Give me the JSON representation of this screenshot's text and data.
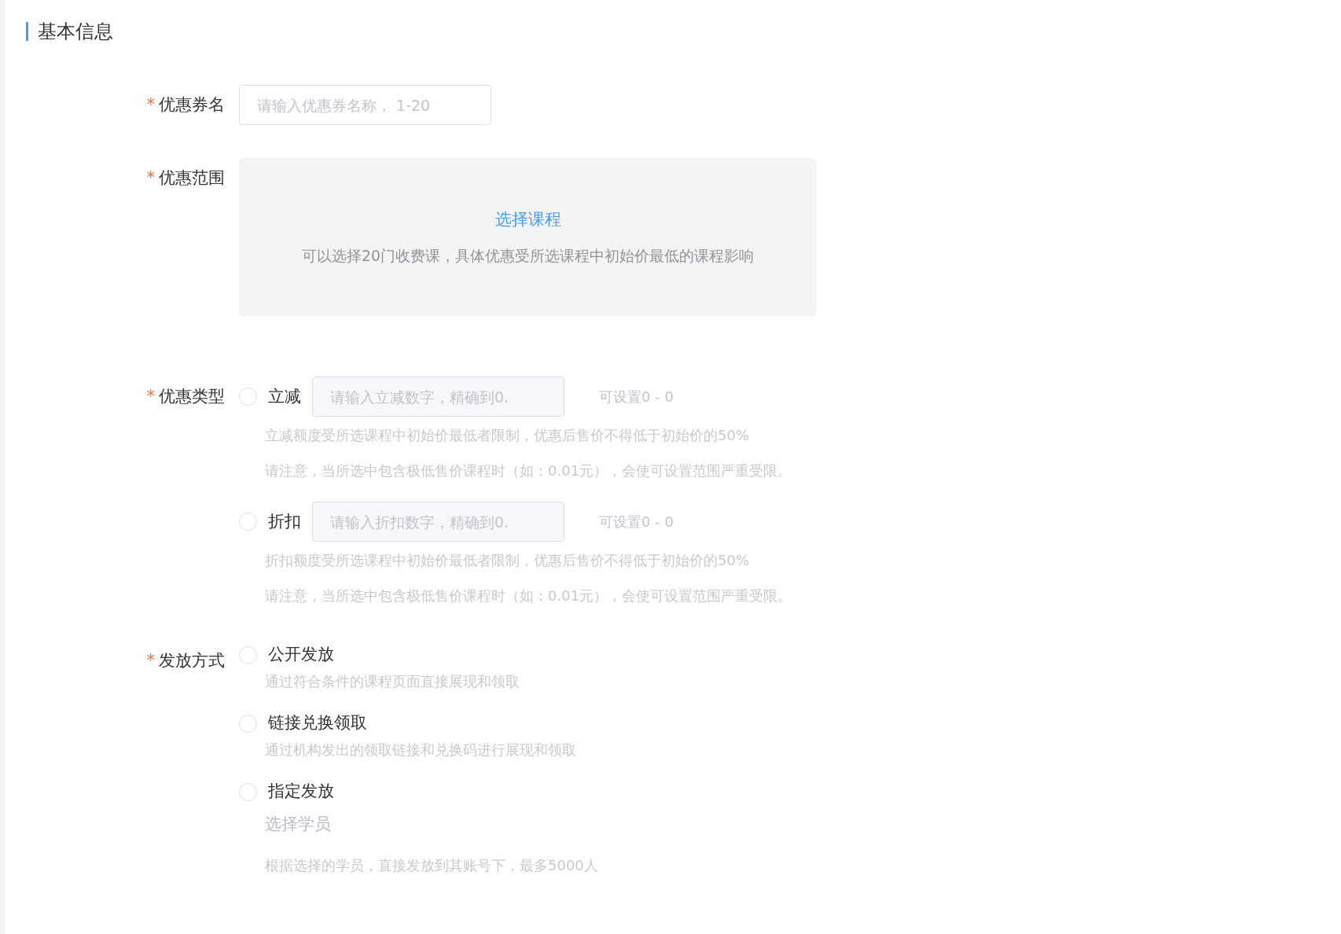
{
  "section_title": "基本信息",
  "fields": [
    {
      "kind": "text",
      "required_mark": "*",
      "label": "优惠券名",
      "placeholder": "请输入优惠券名称， 1-20"
    },
    {
      "kind": "scope",
      "required_mark": "*",
      "label": "优惠范围",
      "link": "选择课程",
      "hint": "可以选择20门收费课，具体优惠受所选课程中初始价最低的课程影响"
    },
    {
      "kind": "radio_inputs",
      "required_mark": "*",
      "label": "优惠类型",
      "options": [
        {
          "label": "立减",
          "selected": false,
          "placeholder": "请输入立减数字，精确到0.",
          "range": "可设置0 - 0",
          "notes": [
            "立减额度受所选课程中初始价最低者限制，优惠后售价不得低于初始价的50%",
            "请注意，当所选中包含极低售价课程时（如：0.01元），会使可设置范围严重受限。"
          ]
        },
        {
          "label": "折扣",
          "selected": false,
          "placeholder": "请输入折扣数字，精确到0.",
          "range": "可设置0 - 0",
          "notes": [
            "折扣额度受所选课程中初始价最低者限制，优惠后售价不得低于初始价的50%",
            "请注意，当所选中包含极低售价课程时（如：0.01元），会使可设置范围严重受限。"
          ]
        }
      ]
    },
    {
      "kind": "radio_list",
      "required_mark": "*",
      "label": "发放方式",
      "options": [
        {
          "label": "公开发放",
          "selected": false,
          "notes": [
            "通过符合条件的课程页面直接展现和领取"
          ]
        },
        {
          "label": "链接兑换领取",
          "selected": false,
          "notes": [
            "通过机构发出的领取链接和兑换码进行展现和领取"
          ]
        },
        {
          "label": "指定发放",
          "selected": false,
          "action": "选择学员",
          "notes": [
            "根据选择的学员，直接发放到其账号下，最多5000人"
          ]
        }
      ]
    }
  ]
}
